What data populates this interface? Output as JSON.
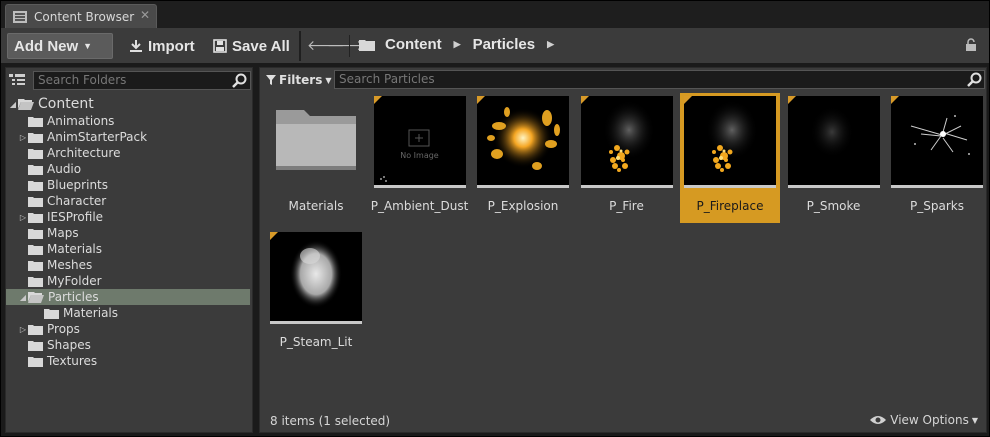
{
  "tab": {
    "label": "Content Browser",
    "close": "✕"
  },
  "toolbar": {
    "add_new": "Add New",
    "import": "Import",
    "save_all": "Save All",
    "breadcrumb": [
      "Content",
      "Particles"
    ]
  },
  "folders": {
    "search_placeholder": "Search Folders",
    "root": "Content",
    "items": [
      {
        "label": "Animations",
        "indent": 1,
        "expandable": false
      },
      {
        "label": "AnimStarterPack",
        "indent": 1,
        "expandable": true
      },
      {
        "label": "Architecture",
        "indent": 1,
        "expandable": false
      },
      {
        "label": "Audio",
        "indent": 1,
        "expandable": false
      },
      {
        "label": "Blueprints",
        "indent": 1,
        "expandable": false
      },
      {
        "label": "Character",
        "indent": 1,
        "expandable": false
      },
      {
        "label": "IESProfile",
        "indent": 1,
        "expandable": true
      },
      {
        "label": "Maps",
        "indent": 1,
        "expandable": false
      },
      {
        "label": "Materials",
        "indent": 1,
        "expandable": false
      },
      {
        "label": "Meshes",
        "indent": 1,
        "expandable": false
      },
      {
        "label": "MyFolder",
        "indent": 1,
        "expandable": false
      },
      {
        "label": "Particles",
        "indent": 1,
        "expandable": true,
        "expanded": true,
        "selected": true
      },
      {
        "label": "Materials",
        "indent": 2,
        "expandable": false
      },
      {
        "label": "Props",
        "indent": 1,
        "expandable": true
      },
      {
        "label": "Shapes",
        "indent": 1,
        "expandable": false
      },
      {
        "label": "Textures",
        "indent": 1,
        "expandable": false
      }
    ]
  },
  "assets": {
    "filters_label": "Filters",
    "search_placeholder": "Search Particles",
    "items": [
      {
        "name": "Materials",
        "kind": "folder"
      },
      {
        "name": "P_Ambient_Dust",
        "kind": "noimage",
        "noimage_text": "No Image"
      },
      {
        "name": "P_Explosion",
        "kind": "explosion"
      },
      {
        "name": "P_Fire",
        "kind": "fire"
      },
      {
        "name": "P_Fireplace",
        "kind": "fire",
        "selected": true
      },
      {
        "name": "P_Smoke",
        "kind": "smoke"
      },
      {
        "name": "P_Sparks",
        "kind": "sparks"
      },
      {
        "name": "P_Steam_Lit",
        "kind": "steam"
      }
    ],
    "status": "8 items (1 selected)",
    "view_options": "View Options"
  },
  "colors": {
    "accent": "#d69a22",
    "selected_folder": "#6e7a6c",
    "panel": "#3b3b3b"
  }
}
